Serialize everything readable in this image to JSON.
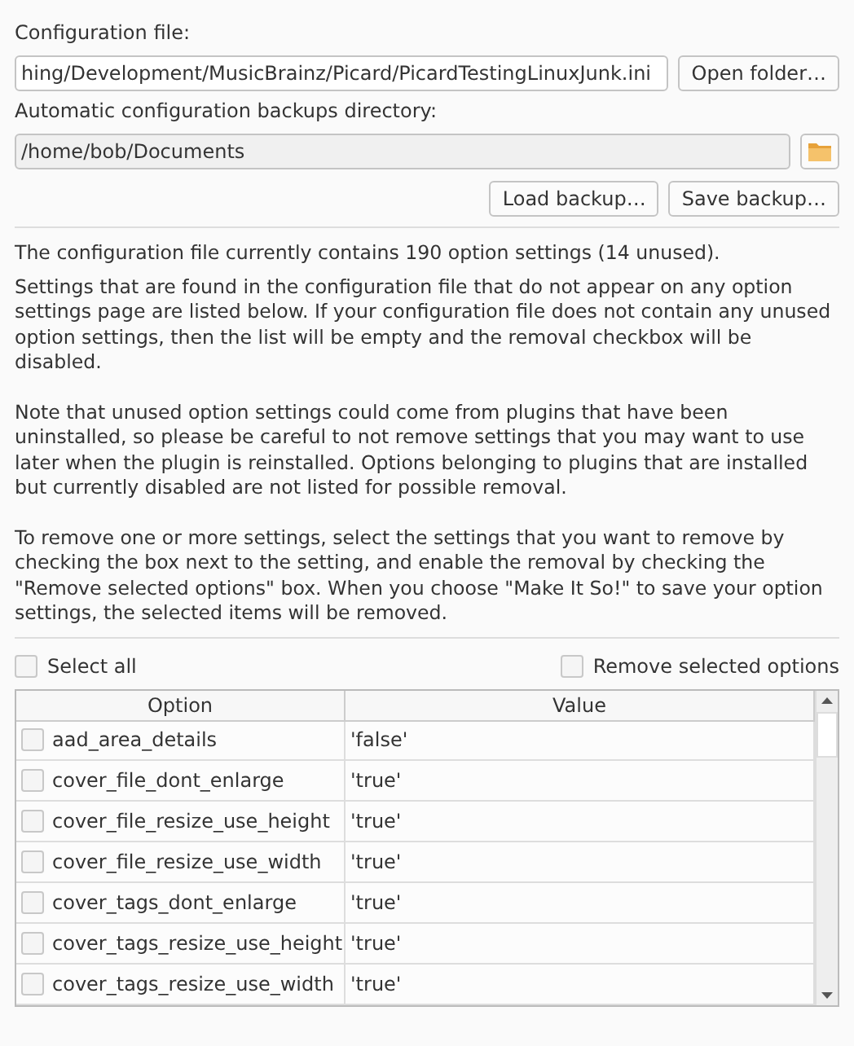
{
  "config_file": {
    "label": "Configuration file:",
    "value": "hing/Development/MusicBrainz/Picard/PicardTestingLinuxJunk.ini",
    "button": "Open folder…"
  },
  "backup_dir": {
    "label": "Automatic configuration backups directory:",
    "value": "/home/bob/Documents"
  },
  "backup_buttons": [
    "Load backup…",
    "Save backup…"
  ],
  "summary": "The configuration file currently contains 190 option settings (14 unused).",
  "paragraphs": [
    "Settings that are found in the configuration file that do not appear on any option settings page are listed below. If your configuration file does not contain any unused option settings, then the list will be empty and the removal checkbox will be disabled.",
    "Note that unused option settings could come from plugins that have been uninstalled, so please be careful to not remove settings that you may want to use later when the plugin is reinstalled. Options belonging to plugins that are installed but currently disabled are not listed for possible removal.",
    "To remove one or more settings, select the settings that you want to remove by checking the box next to the setting, and enable the removal by checking the \"Remove selected options\" box. When you choose \"Make It So!\" to save your option settings, the selected items will be removed."
  ],
  "select_all": {
    "label": "Select all",
    "checked": false
  },
  "remove_selected": {
    "label": "Remove selected options",
    "checked": false
  },
  "table": {
    "columns": [
      "Option",
      "Value"
    ],
    "rows": [
      {
        "option": "aad_area_details",
        "value": "'false'",
        "checked": false
      },
      {
        "option": "cover_file_dont_enlarge",
        "value": "'true'",
        "checked": false
      },
      {
        "option": "cover_file_resize_use_height",
        "value": "'true'",
        "checked": false
      },
      {
        "option": "cover_file_resize_use_width",
        "value": "'true'",
        "checked": false
      },
      {
        "option": "cover_tags_dont_enlarge",
        "value": "'true'",
        "checked": false
      },
      {
        "option": "cover_tags_resize_use_height",
        "value": "'true'",
        "checked": false
      },
      {
        "option": "cover_tags_resize_use_width",
        "value": "'true'",
        "checked": false
      }
    ]
  }
}
